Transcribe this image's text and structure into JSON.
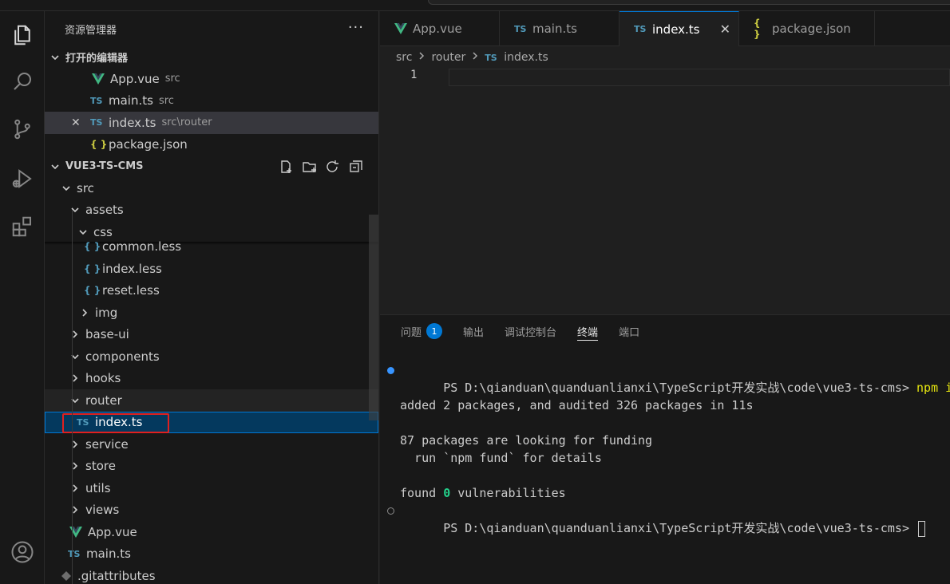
{
  "sidebar": {
    "title": "资源管理器",
    "more": "···",
    "open_editors": {
      "title": "打开的编辑器",
      "items": [
        {
          "name": "App.vue",
          "hint": "src"
        },
        {
          "name": "main.ts",
          "hint": "src"
        },
        {
          "name": "index.ts",
          "hint": "src\\router"
        },
        {
          "name": "package.json",
          "hint": ""
        }
      ]
    },
    "project": {
      "title": "VUE3-TS-CMS",
      "tree": {
        "src": "src",
        "assets": "assets",
        "css": "css",
        "common_less": "common.less",
        "index_less": "index.less",
        "reset_less": "reset.less",
        "img": "img",
        "base_ui": "base-ui",
        "components": "components",
        "hooks": "hooks",
        "router": "router",
        "index_ts": "index.ts",
        "service": "service",
        "store": "store",
        "utils": "utils",
        "views": "views",
        "app_vue": "App.vue",
        "main_ts": "main.ts",
        "gitattributes": ".gitattributes"
      }
    }
  },
  "icons": {
    "ts_label": "TS",
    "json_label": "{ }",
    "less_label": "{ }",
    "vue_color": "#41b883",
    "ts_color": "#519aba",
    "json_color": "#cbcb41"
  },
  "editor": {
    "tabs": [
      {
        "label": "App.vue"
      },
      {
        "label": "main.ts"
      },
      {
        "label": "index.ts",
        "active": true
      },
      {
        "label": "package.json"
      }
    ],
    "close_glyph": "✕",
    "breadcrumb": [
      "src",
      "router",
      "index.ts"
    ],
    "line_number": "1"
  },
  "panel": {
    "tabs": [
      {
        "label": "问题",
        "badge": "1"
      },
      {
        "label": "输出"
      },
      {
        "label": "调试控制台"
      },
      {
        "label": "终端",
        "active": true
      },
      {
        "label": "端口"
      }
    ],
    "terminal": {
      "prompt1": "PS D:\\qianduan\\quanduanlianxi\\TypeScript开发实战\\code\\vue3-ts-cms> ",
      "cmd1": "npm instal",
      "line_added": "added 2 packages, and audited 326 packages in 11s",
      "line_funding": "87 packages are looking for funding",
      "line_fund_detail": "  run `npm fund` for details",
      "found_prefix": "found ",
      "found_count": "0",
      "found_suffix": " vulnerabilities",
      "prompt2": "PS D:\\qianduan\\quanduanlianxi\\TypeScript开发实战\\code\\vue3-ts-cms> ",
      "status_dot_success": "#3794ff",
      "status_dot_idle": "#8b8b8b"
    }
  },
  "accent": "#0078d4",
  "highlight_color": "#e0201f"
}
